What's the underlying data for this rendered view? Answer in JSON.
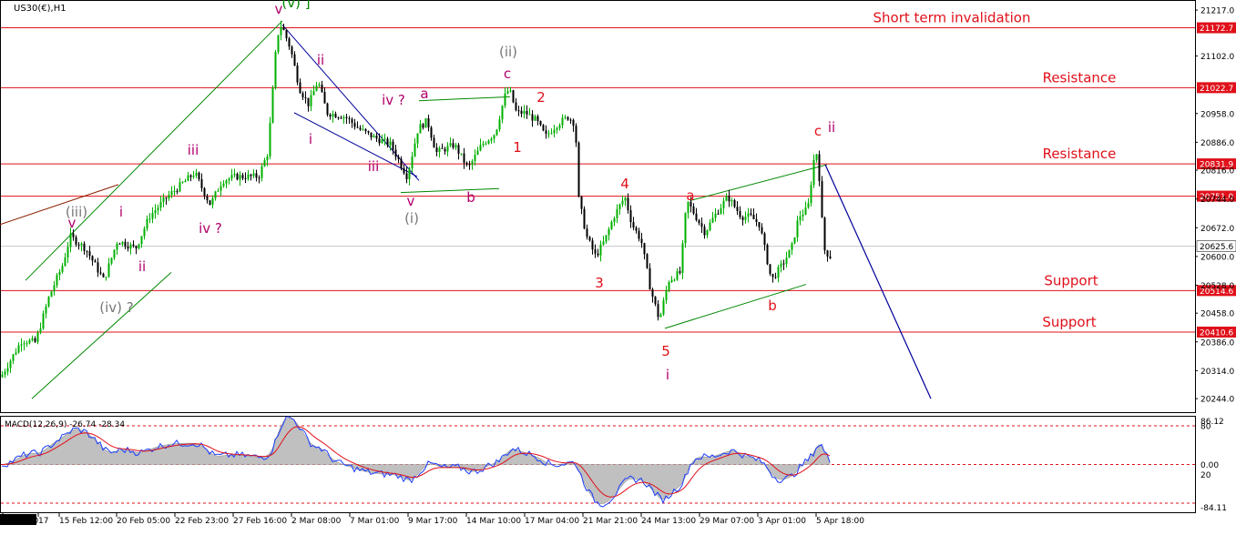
{
  "symbol_label": "US30(€),H1",
  "macd_label": "MACD(12,26,9) -26.74 -28.34",
  "colors": {
    "level_line": "#e0101a",
    "level_tag_bg": "#e0101a",
    "bull_candle": "#00b000",
    "bear_candle": "#000000",
    "channel_green": "#008800",
    "channel_blue": "#000099",
    "projection": "#000099",
    "wave_magenta": "#b0006a",
    "wave_gray": "#777777",
    "wave_red": "#e0101a",
    "macd_hist": "#c0c0c0",
    "macd_line": "#1a3cff",
    "signal_line": "#e0101a",
    "current_price_line": "#c8c8c8"
  },
  "price_axis": {
    "ticks": [
      "21217.0",
      "21102.0",
      "20958.0",
      "20886.0",
      "20816.0",
      "20744.0",
      "20672.0",
      "20600.0",
      "20528.0",
      "20458.0",
      "20386.0",
      "20314.0",
      "20244.0"
    ]
  },
  "levels": [
    {
      "price": 21172.7,
      "tag": "21172.7",
      "text": "Short term invalidation"
    },
    {
      "price": 21022.7,
      "tag": "21022.7",
      "text": "Resistance"
    },
    {
      "price": 20831.9,
      "tag": "20831.9",
      "text": "Resistance"
    },
    {
      "price": 20751.0,
      "tag": "20751.0",
      "text": ""
    },
    {
      "price": 20514.6,
      "tag": "20514.6",
      "text": "Support"
    },
    {
      "price": 20410.6,
      "tag": "20410.6",
      "text": "Support"
    }
  ],
  "current_price": {
    "price": 20625.6,
    "tag": "20625.6"
  },
  "date_axis": {
    "labels": [
      "10 19:00",
      "17",
      "15 Feb 12:00",
      "20 Feb 05:00",
      "22 Feb 23:00",
      "27 Feb 16:00",
      "2 Mar 08:00",
      "7 Mar 01:00",
      "9 Mar 17:00",
      "14 Mar 10:00",
      "17 Mar 04:00",
      "21 Mar 21:00",
      "24 Mar 13:00",
      "29 Mar 07:00",
      "3 Apr 01:00",
      "5 Apr 18:00"
    ]
  },
  "wave_labels": [
    {
      "text": "v",
      "color": "wave_magenta"
    },
    {
      "text": "(v) ]",
      "color": "channel_green"
    },
    {
      "text": "(iii)",
      "color": "wave_gray"
    },
    {
      "text": "v",
      "color": "wave_magenta"
    },
    {
      "text": "i",
      "color": "wave_magenta"
    },
    {
      "text": "iii",
      "color": "wave_magenta"
    },
    {
      "text": "ii",
      "color": "wave_magenta"
    },
    {
      "text": "iv ?",
      "color": "wave_magenta"
    },
    {
      "text": "(iv) ?",
      "color": "wave_gray"
    },
    {
      "text": "ii",
      "color": "wave_magenta"
    },
    {
      "text": "i",
      "color": "wave_magenta"
    },
    {
      "text": "iii",
      "color": "wave_magenta"
    },
    {
      "text": "iv ?",
      "color": "wave_magenta"
    },
    {
      "text": "v",
      "color": "wave_magenta"
    },
    {
      "text": "(i)",
      "color": "wave_gray"
    },
    {
      "text": "a",
      "color": "wave_magenta"
    },
    {
      "text": "b",
      "color": "wave_magenta"
    },
    {
      "text": "(ii)",
      "color": "wave_gray"
    },
    {
      "text": "c",
      "color": "wave_magenta"
    },
    {
      "text": "1",
      "color": "wave_red"
    },
    {
      "text": "2",
      "color": "wave_red"
    },
    {
      "text": "3",
      "color": "wave_red"
    },
    {
      "text": "4",
      "color": "wave_red"
    },
    {
      "text": "5",
      "color": "wave_red"
    },
    {
      "text": "i",
      "color": "wave_magenta"
    },
    {
      "text": "a",
      "color": "wave_red"
    },
    {
      "text": "b",
      "color": "wave_red"
    },
    {
      "text": "c",
      "color": "wave_red"
    },
    {
      "text": "ii",
      "color": "wave_magenta"
    }
  ],
  "macd_axis": {
    "ticks": [
      "86.12",
      "80",
      "0.00",
      "20",
      "-84.11"
    ]
  },
  "chart_data": {
    "type": "candlestick",
    "instrument": "US30(€)",
    "timeframe": "H1",
    "ylim": [
      20210,
      21240
    ],
    "path_points": [
      [
        0,
        20290
      ],
      [
        10,
        20330
      ],
      [
        25,
        20390
      ],
      [
        40,
        20385
      ],
      [
        55,
        20500
      ],
      [
        70,
        20580
      ],
      [
        78,
        20650
      ],
      [
        95,
        20620
      ],
      [
        115,
        20540
      ],
      [
        130,
        20640
      ],
      [
        150,
        20620
      ],
      [
        165,
        20700
      ],
      [
        185,
        20750
      ],
      [
        205,
        20790
      ],
      [
        215,
        20810
      ],
      [
        225,
        20760
      ],
      [
        232,
        20730
      ],
      [
        245,
        20790
      ],
      [
        260,
        20800
      ],
      [
        285,
        20800
      ],
      [
        295,
        20860
      ],
      [
        300,
        21000
      ],
      [
        305,
        21150
      ],
      [
        310,
        21180
      ],
      [
        320,
        21120
      ],
      [
        330,
        21020
      ],
      [
        340,
        20980
      ],
      [
        350,
        21040
      ],
      [
        360,
        20960
      ],
      [
        380,
        20950
      ],
      [
        395,
        20920
      ],
      [
        410,
        20900
      ],
      [
        430,
        20880
      ],
      [
        448,
        20800
      ],
      [
        460,
        20920
      ],
      [
        470,
        20940
      ],
      [
        480,
        20860
      ],
      [
        500,
        20880
      ],
      [
        515,
        20820
      ],
      [
        530,
        20880
      ],
      [
        545,
        20910
      ],
      [
        555,
        21000
      ],
      [
        560,
        21020
      ],
      [
        568,
        20960
      ],
      [
        578,
        20960
      ],
      [
        590,
        20940
      ],
      [
        600,
        20900
      ],
      [
        612,
        20930
      ],
      [
        625,
        20950
      ],
      [
        633,
        20930
      ],
      [
        635,
        20760
      ],
      [
        645,
        20650
      ],
      [
        655,
        20600
      ],
      [
        665,
        20640
      ],
      [
        675,
        20700
      ],
      [
        687,
        20750
      ],
      [
        695,
        20680
      ],
      [
        705,
        20640
      ],
      [
        715,
        20520
      ],
      [
        725,
        20440
      ],
      [
        735,
        20540
      ],
      [
        748,
        20560
      ],
      [
        755,
        20740
      ],
      [
        765,
        20700
      ],
      [
        775,
        20660
      ],
      [
        785,
        20700
      ],
      [
        800,
        20750
      ],
      [
        815,
        20700
      ],
      [
        825,
        20700
      ],
      [
        835,
        20680
      ],
      [
        848,
        20540
      ],
      [
        860,
        20580
      ],
      [
        870,
        20620
      ],
      [
        878,
        20700
      ],
      [
        888,
        20720
      ],
      [
        895,
        20850
      ],
      [
        898,
        20860
      ],
      [
        902,
        20760
      ],
      [
        905,
        20620
      ],
      [
        912,
        20600
      ]
    ],
    "projection": [
      [
        906,
        20830
      ],
      [
        1022,
        20244
      ]
    ],
    "channels": [
      {
        "color": "channel_green",
        "from": [
          28,
          20540
        ],
        "to": [
          310,
          21190
        ]
      },
      {
        "color": "channel_green",
        "from": [
          35,
          20244
        ],
        "to": [
          188,
          20560
        ]
      },
      {
        "color": "#8b2000",
        "from": [
          0,
          20680
        ],
        "to": [
          130,
          20780
        ]
      },
      {
        "color": "channel_blue",
        "from": [
          310,
          21180
        ],
        "to": [
          460,
          20790
        ]
      },
      {
        "color": "channel_blue",
        "from": [
          323,
          20960
        ],
        "to": [
          458,
          20800
        ]
      },
      {
        "color": "channel_green",
        "from": [
          460,
          20990
        ],
        "to": [
          560,
          21000
        ]
      },
      {
        "color": "channel_green",
        "from": [
          440,
          20760
        ],
        "to": [
          548,
          20770
        ]
      },
      {
        "color": "channel_green",
        "from": [
          730,
          20420
        ],
        "to": [
          885,
          20530
        ]
      },
      {
        "color": "channel_green",
        "from": [
          758,
          20740
        ],
        "to": [
          908,
          20830
        ]
      }
    ],
    "macd": {
      "ylim": [
        -92,
        92
      ],
      "params": "12,26,9",
      "value": -26.74,
      "signal": -28.34
    }
  }
}
